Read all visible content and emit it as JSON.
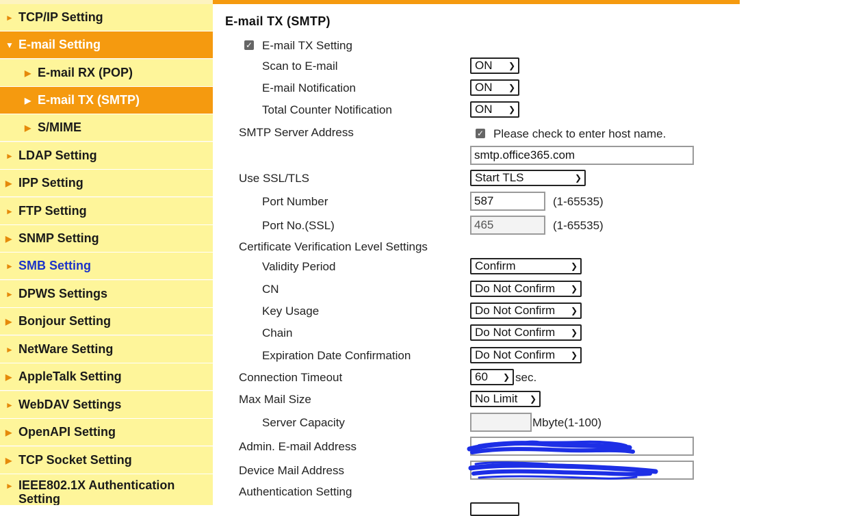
{
  "sidebar": {
    "items": [
      {
        "label": "TCP/IP Setting",
        "icon": "flag-arrow-icon"
      },
      {
        "label": "E-mail Setting",
        "icon": "triangle-down-icon"
      },
      {
        "label": "E-mail RX (POP)",
        "icon": "triangle-right-icon"
      },
      {
        "label": "E-mail TX (SMTP)",
        "icon": "triangle-right-icon"
      },
      {
        "label": "S/MIME",
        "icon": "triangle-right-icon"
      },
      {
        "label": "LDAP Setting",
        "icon": "flag-arrow-icon"
      },
      {
        "label": "IPP Setting",
        "icon": "triangle-right-icon"
      },
      {
        "label": "FTP Setting",
        "icon": "flag-arrow-icon"
      },
      {
        "label": "SNMP Setting",
        "icon": "triangle-right-icon"
      },
      {
        "label": "SMB Setting",
        "icon": "flag-arrow-icon"
      },
      {
        "label": "DPWS Settings",
        "icon": "flag-arrow-icon"
      },
      {
        "label": "Bonjour Setting",
        "icon": "triangle-right-icon"
      },
      {
        "label": "NetWare Setting",
        "icon": "flag-arrow-icon"
      },
      {
        "label": "AppleTalk Setting",
        "icon": "triangle-right-icon"
      },
      {
        "label": "WebDAV Settings",
        "icon": "flag-arrow-icon"
      },
      {
        "label": "OpenAPI Setting",
        "icon": "triangle-right-icon"
      },
      {
        "label": "TCP Socket Setting",
        "icon": "triangle-right-icon"
      },
      {
        "label": "IEEE802.1X Authentication Setting",
        "icon": "flag-arrow-icon"
      }
    ]
  },
  "page": {
    "title": "E-mail TX (SMTP)",
    "email_tx_setting_label": "E-mail TX Setting",
    "scan_to_email_label": "Scan to E-mail",
    "scan_to_email_value": "ON",
    "email_notification_label": "E-mail Notification",
    "email_notification_value": "ON",
    "total_counter_label": "Total Counter Notification",
    "total_counter_value": "ON",
    "smtp_server_label": "SMTP Server Address",
    "host_name_check_label": "Please check to enter host name.",
    "smtp_server_value": "smtp.office365.com",
    "ssl_label": "Use SSL/TLS",
    "ssl_value": "Start TLS",
    "port_label": "Port Number",
    "port_value": "587",
    "port_range": "(1-65535)",
    "port_ssl_label": "Port No.(SSL)",
    "port_ssl_value": "465",
    "port_ssl_range": "(1-65535)",
    "cert_label": "Certificate Verification Level Settings",
    "validity_label": "Validity Period",
    "validity_value": "Confirm",
    "cn_label": "CN",
    "cn_value": "Do Not Confirm",
    "key_usage_label": "Key Usage",
    "key_usage_value": "Do Not Confirm",
    "chain_label": "Chain",
    "chain_value": "Do Not Confirm",
    "expiration_label": "Expiration Date Confirmation",
    "expiration_value": "Do Not Confirm",
    "timeout_label": "Connection Timeout",
    "timeout_value": "60",
    "timeout_unit": "sec.",
    "max_mail_label": "Max Mail Size",
    "max_mail_value": "No Limit",
    "server_capacity_label": "Server Capacity",
    "server_capacity_value": "",
    "server_capacity_unit": "Mbyte(1-100)",
    "admin_email_label": "Admin. E-mail Address",
    "device_mail_label": "Device Mail Address",
    "auth_label": "Authentication Setting"
  },
  "colors": {
    "accent_orange": "#f59a0f",
    "sidebar_yellow": "#fef59a",
    "link_blue": "#1b33c9",
    "redaction_blue": "#1d2fe6"
  }
}
